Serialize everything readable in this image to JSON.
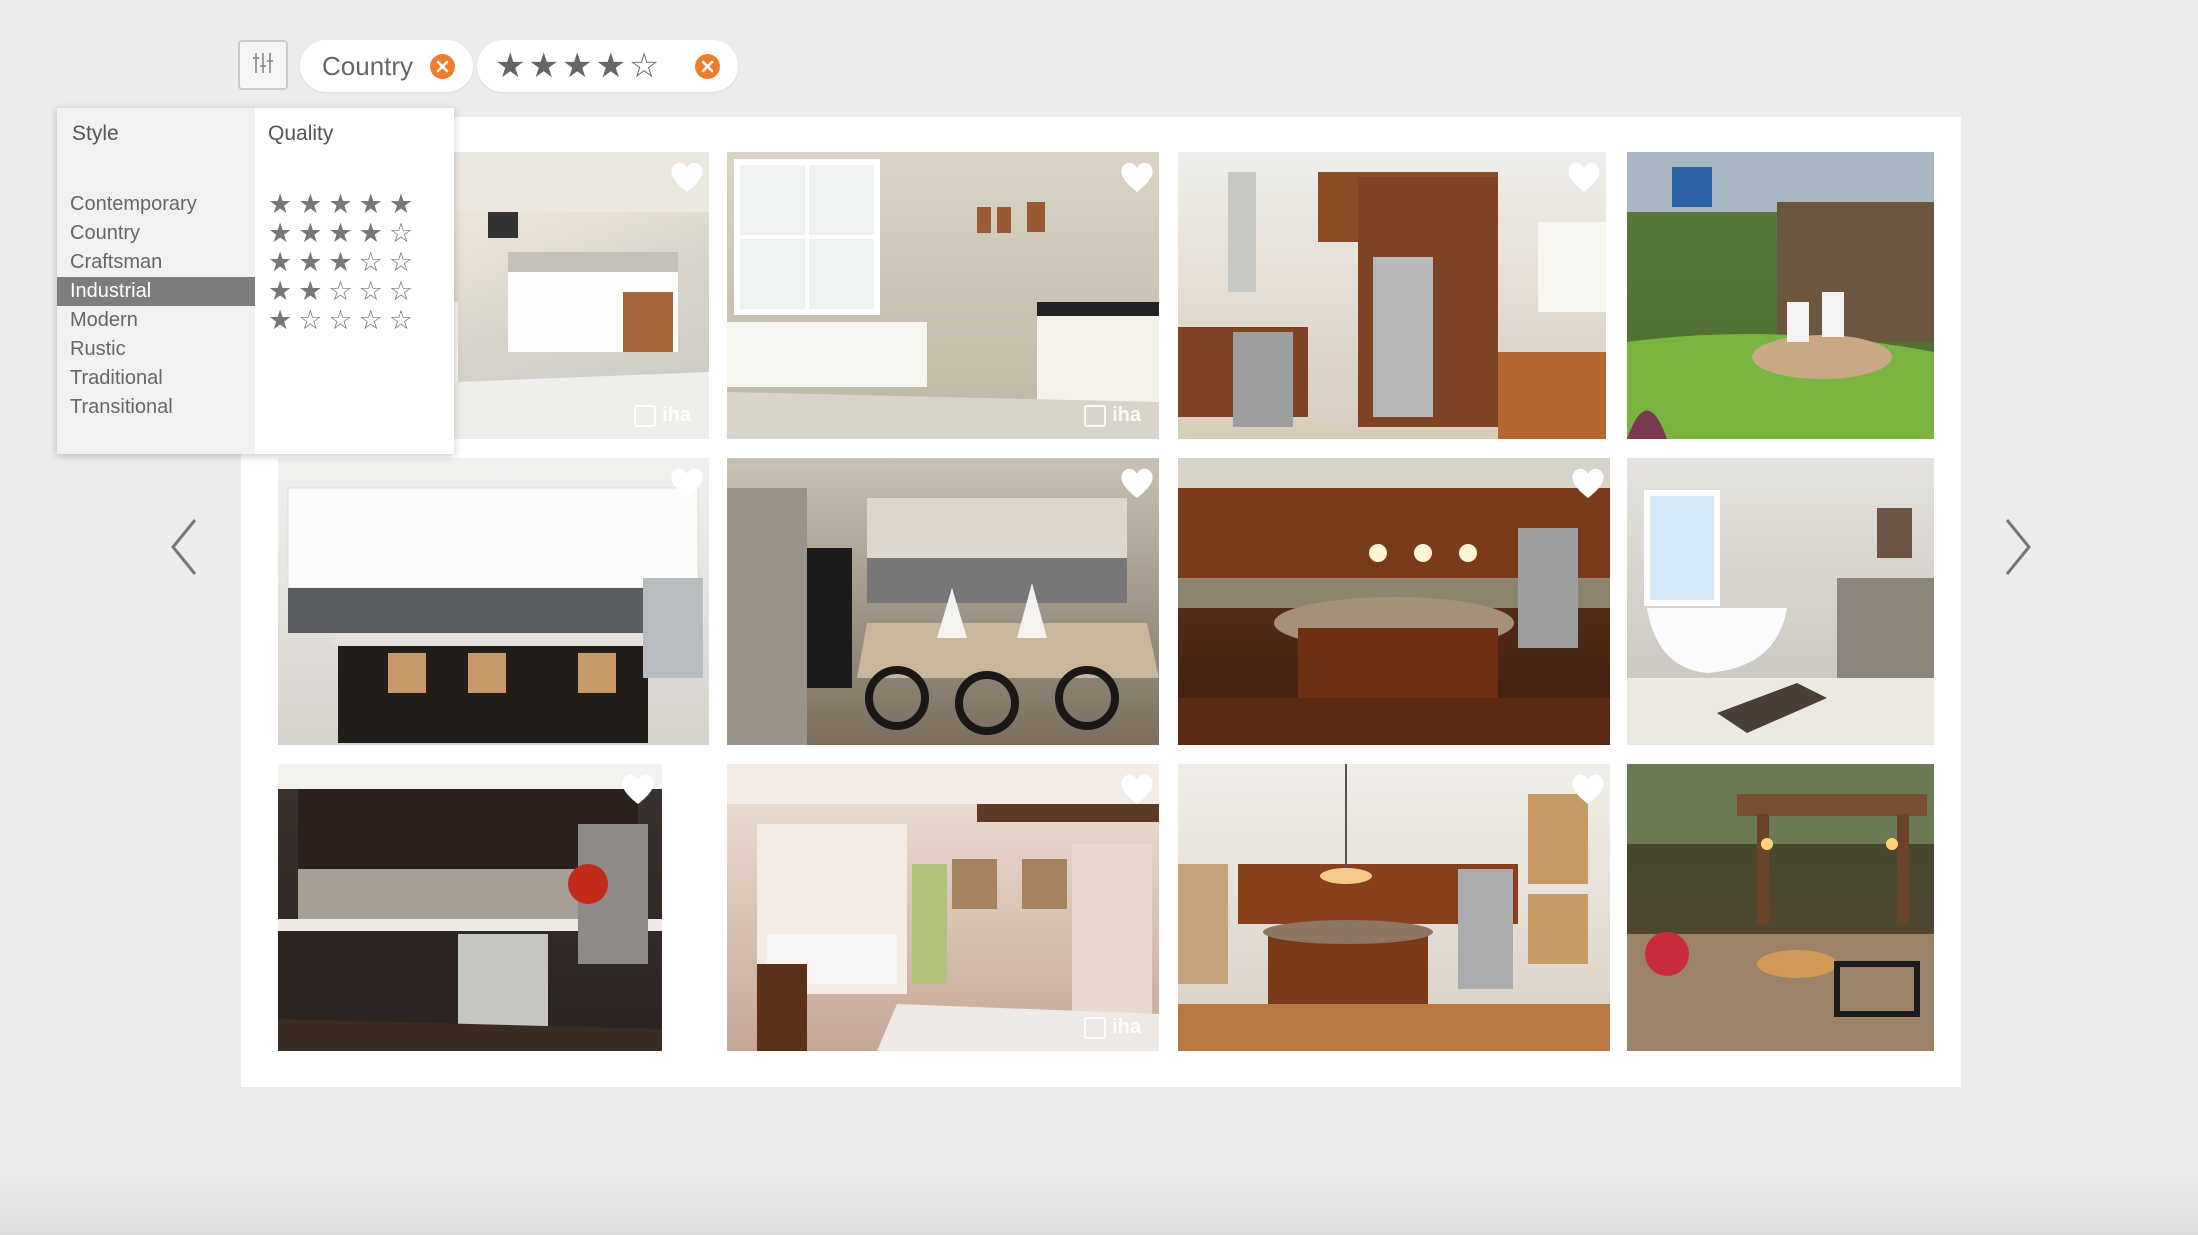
{
  "filters": {
    "country_chip": {
      "label": "Country"
    },
    "quality_chip": {
      "stars": "★★★★☆",
      "rating": 4
    }
  },
  "dropdown": {
    "style_heading": "Style",
    "quality_heading": "Quality",
    "styles": [
      "Contemporary",
      "Country",
      "Craftsman",
      "Industrial",
      "Modern",
      "Rustic",
      "Traditional",
      "Transitional"
    ],
    "selected_style": "Industrial",
    "quality_options": [
      "★★★★★",
      "★★★★☆",
      "★★★☆☆",
      "★★☆☆☆",
      "★☆☆☆☆"
    ]
  },
  "gallery": {
    "watermark_text": "iha",
    "images": [
      {
        "name": "white-kitchen-tiled-floor",
        "watermark": true
      },
      {
        "name": "bathroom-bathtub-window",
        "watermark": true
      },
      {
        "name": "wood-kitchen-steel-fridge",
        "watermark": false
      },
      {
        "name": "backyard-garden-firepit",
        "watermark": false
      },
      {
        "name": "white-kitchen-black-island",
        "watermark": false
      },
      {
        "name": "grey-kitchen-bar-stools",
        "watermark": false
      },
      {
        "name": "cherry-kitchen-pendants",
        "watermark": false
      },
      {
        "name": "bathroom-freestanding-tub",
        "watermark": false
      },
      {
        "name": "dark-kitchen-mosaic-backsplash",
        "watermark": false
      },
      {
        "name": "cottage-dining-kitchen",
        "watermark": true
      },
      {
        "name": "wood-kitchen-vaulted-ceiling",
        "watermark": false
      },
      {
        "name": "patio-pergola-evening",
        "watermark": false
      }
    ]
  },
  "colors": {
    "accent": "#ee7d2b",
    "background": "#ececec",
    "selected_row": "#7d7d7d"
  },
  "icons": {
    "filter": "sliders-icon",
    "remove": "close-circle-icon",
    "favorite": "heart-icon",
    "prev": "chevron-left-icon",
    "next": "chevron-right-icon"
  }
}
